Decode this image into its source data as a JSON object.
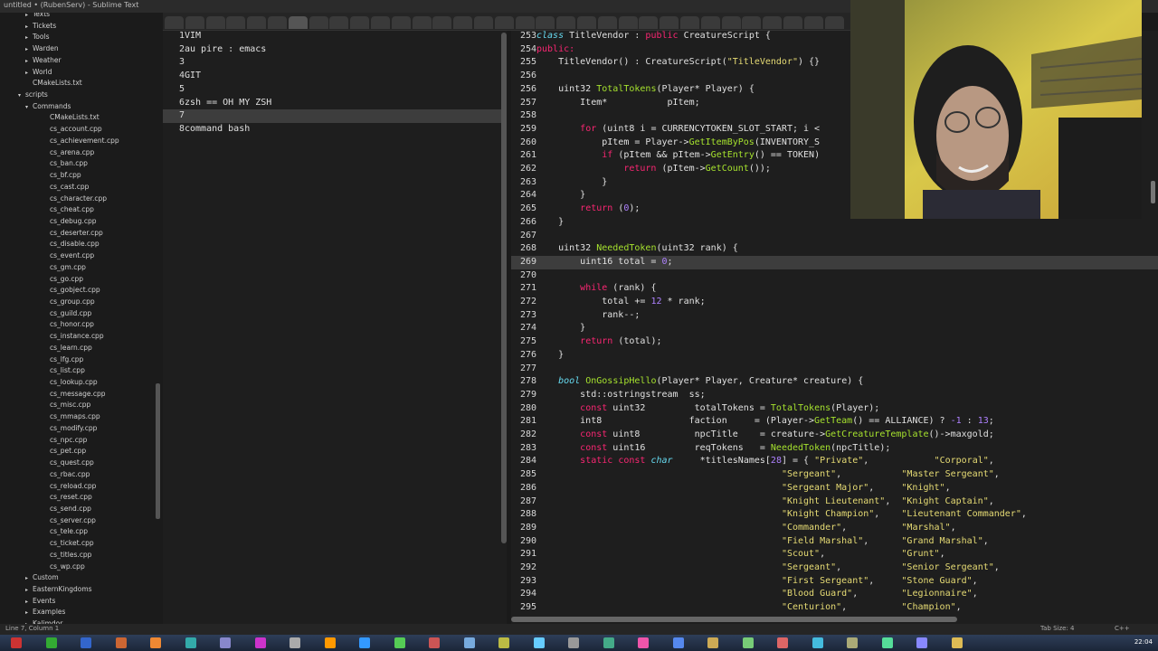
{
  "window": {
    "title": "untitled • (RubenServ) - Sublime Text"
  },
  "sidebar": {
    "items": [
      {
        "label": "Texts",
        "depth": 3,
        "arrow": "▸"
      },
      {
        "label": "Tickets",
        "depth": 3,
        "arrow": "▸"
      },
      {
        "label": "Tools",
        "depth": 3,
        "arrow": "▸"
      },
      {
        "label": "Warden",
        "depth": 3,
        "arrow": "▸"
      },
      {
        "label": "Weather",
        "depth": 3,
        "arrow": "▸"
      },
      {
        "label": "World",
        "depth": 3,
        "arrow": "▸"
      },
      {
        "label": "CMakeLists.txt",
        "depth": 3,
        "arrow": ""
      },
      {
        "label": "scripts",
        "depth": 2,
        "arrow": "▾"
      },
      {
        "label": "Commands",
        "depth": 3,
        "arrow": "▾"
      },
      {
        "label": "CMakeLists.txt",
        "depth": 4,
        "arrow": ""
      },
      {
        "label": "cs_account.cpp",
        "depth": 4,
        "arrow": ""
      },
      {
        "label": "cs_achievement.cpp",
        "depth": 4,
        "arrow": ""
      },
      {
        "label": "cs_arena.cpp",
        "depth": 4,
        "arrow": ""
      },
      {
        "label": "cs_ban.cpp",
        "depth": 4,
        "arrow": ""
      },
      {
        "label": "cs_bf.cpp",
        "depth": 4,
        "arrow": ""
      },
      {
        "label": "cs_cast.cpp",
        "depth": 4,
        "arrow": ""
      },
      {
        "label": "cs_character.cpp",
        "depth": 4,
        "arrow": ""
      },
      {
        "label": "cs_cheat.cpp",
        "depth": 4,
        "arrow": ""
      },
      {
        "label": "cs_debug.cpp",
        "depth": 4,
        "arrow": ""
      },
      {
        "label": "cs_deserter.cpp",
        "depth": 4,
        "arrow": ""
      },
      {
        "label": "cs_disable.cpp",
        "depth": 4,
        "arrow": ""
      },
      {
        "label": "cs_event.cpp",
        "depth": 4,
        "arrow": ""
      },
      {
        "label": "cs_gm.cpp",
        "depth": 4,
        "arrow": ""
      },
      {
        "label": "cs_go.cpp",
        "depth": 4,
        "arrow": ""
      },
      {
        "label": "cs_gobject.cpp",
        "depth": 4,
        "arrow": ""
      },
      {
        "label": "cs_group.cpp",
        "depth": 4,
        "arrow": ""
      },
      {
        "label": "cs_guild.cpp",
        "depth": 4,
        "arrow": ""
      },
      {
        "label": "cs_honor.cpp",
        "depth": 4,
        "arrow": ""
      },
      {
        "label": "cs_instance.cpp",
        "depth": 4,
        "arrow": ""
      },
      {
        "label": "cs_learn.cpp",
        "depth": 4,
        "arrow": ""
      },
      {
        "label": "cs_lfg.cpp",
        "depth": 4,
        "arrow": ""
      },
      {
        "label": "cs_list.cpp",
        "depth": 4,
        "arrow": ""
      },
      {
        "label": "cs_lookup.cpp",
        "depth": 4,
        "arrow": ""
      },
      {
        "label": "cs_message.cpp",
        "depth": 4,
        "arrow": ""
      },
      {
        "label": "cs_misc.cpp",
        "depth": 4,
        "arrow": ""
      },
      {
        "label": "cs_mmaps.cpp",
        "depth": 4,
        "arrow": ""
      },
      {
        "label": "cs_modify.cpp",
        "depth": 4,
        "arrow": ""
      },
      {
        "label": "cs_npc.cpp",
        "depth": 4,
        "arrow": ""
      },
      {
        "label": "cs_pet.cpp",
        "depth": 4,
        "arrow": ""
      },
      {
        "label": "cs_quest.cpp",
        "depth": 4,
        "arrow": ""
      },
      {
        "label": "cs_rbac.cpp",
        "depth": 4,
        "arrow": ""
      },
      {
        "label": "cs_reload.cpp",
        "depth": 4,
        "arrow": ""
      },
      {
        "label": "cs_reset.cpp",
        "depth": 4,
        "arrow": ""
      },
      {
        "label": "cs_send.cpp",
        "depth": 4,
        "arrow": ""
      },
      {
        "label": "cs_server.cpp",
        "depth": 4,
        "arrow": ""
      },
      {
        "label": "cs_tele.cpp",
        "depth": 4,
        "arrow": ""
      },
      {
        "label": "cs_ticket.cpp",
        "depth": 4,
        "arrow": ""
      },
      {
        "label": "cs_titles.cpp",
        "depth": 4,
        "arrow": ""
      },
      {
        "label": "cs_wp.cpp",
        "depth": 4,
        "arrow": ""
      },
      {
        "label": "Custom",
        "depth": 3,
        "arrow": "▸"
      },
      {
        "label": "EasternKingdoms",
        "depth": 3,
        "arrow": "▸"
      },
      {
        "label": "Events",
        "depth": 3,
        "arrow": "▸"
      },
      {
        "label": "Examples",
        "depth": 3,
        "arrow": "▸"
      },
      {
        "label": "Kalimdor",
        "depth": 3,
        "arrow": "▸"
      }
    ]
  },
  "left_editor": {
    "highlight_line": 7,
    "lines": [
      {
        "n": "1",
        "segs": [
          [
            "VIM",
            ""
          ]
        ]
      },
      {
        "n": "2",
        "segs": [
          [
            "au pire : emacs",
            ""
          ]
        ]
      },
      {
        "n": "3",
        "segs": [
          [
            "",
            ""
          ]
        ]
      },
      {
        "n": "4",
        "segs": [
          [
            "GIT",
            ""
          ]
        ]
      },
      {
        "n": "5",
        "segs": [
          [
            "",
            ""
          ]
        ]
      },
      {
        "n": "6",
        "segs": [
          [
            "zsh == OH MY ZSH",
            ""
          ]
        ]
      },
      {
        "n": "7",
        "segs": [
          [
            "",
            ""
          ]
        ]
      },
      {
        "n": "8",
        "segs": [
          [
            "command bash",
            ""
          ]
        ]
      }
    ]
  },
  "right_editor": {
    "highlight_line": 269,
    "lines": [
      {
        "n": "253",
        "segs": [
          [
            "class",
            "ty"
          ],
          [
            " TitleVendor : ",
            ""
          ],
          [
            "public",
            "kw"
          ],
          [
            " CreatureScript {",
            ""
          ]
        ]
      },
      {
        "n": "254",
        "segs": [
          [
            "public:",
            "acc"
          ]
        ]
      },
      {
        "n": "255",
        "segs": [
          [
            "    TitleVendor() : CreatureScript(",
            ""
          ],
          [
            "\"TitleVendor\"",
            "str"
          ],
          [
            ") {}",
            ""
          ]
        ]
      },
      {
        "n": "256",
        "segs": [
          [
            "",
            ""
          ]
        ]
      },
      {
        "n": "256",
        "segs": [
          [
            "    uint32 ",
            ""
          ],
          [
            "TotalTokens",
            "fn"
          ],
          [
            "(Player* Player) {",
            ""
          ]
        ]
      },
      {
        "n": "257",
        "segs": [
          [
            "        Item*           pItem;",
            ""
          ]
        ]
      },
      {
        "n": "258",
        "segs": [
          [
            "",
            ""
          ]
        ]
      },
      {
        "n": "259",
        "segs": [
          [
            "        ",
            ""
          ],
          [
            "for",
            "kw"
          ],
          [
            " (uint8 i = CURRENCYTOKEN_SLOT_START; i <",
            ""
          ]
        ]
      },
      {
        "n": "260",
        "segs": [
          [
            "            pItem = Player->",
            ""
          ],
          [
            "GetItemByPos",
            "fn"
          ],
          [
            "(INVENTORY_S",
            ""
          ]
        ]
      },
      {
        "n": "261",
        "segs": [
          [
            "            ",
            ""
          ],
          [
            "if",
            "kw"
          ],
          [
            " (pItem && pItem->",
            ""
          ],
          [
            "GetEntry",
            "fn"
          ],
          [
            "() == TOKEN)",
            ""
          ]
        ]
      },
      {
        "n": "262",
        "segs": [
          [
            "                ",
            ""
          ],
          [
            "return",
            "kw"
          ],
          [
            " (pItem->",
            ""
          ],
          [
            "GetCount",
            "fn"
          ],
          [
            "());",
            ""
          ]
        ]
      },
      {
        "n": "263",
        "segs": [
          [
            "            }",
            ""
          ]
        ]
      },
      {
        "n": "264",
        "segs": [
          [
            "        }",
            ""
          ]
        ]
      },
      {
        "n": "265",
        "segs": [
          [
            "        ",
            ""
          ],
          [
            "return",
            "kw"
          ],
          [
            " (",
            ""
          ],
          [
            "0",
            "num"
          ],
          [
            ");",
            ""
          ]
        ]
      },
      {
        "n": "266",
        "segs": [
          [
            "    }",
            ""
          ]
        ]
      },
      {
        "n": "267",
        "segs": [
          [
            "",
            ""
          ]
        ]
      },
      {
        "n": "268",
        "segs": [
          [
            "    uint32 ",
            ""
          ],
          [
            "NeededToken",
            "fn"
          ],
          [
            "(uint32 rank) {",
            ""
          ]
        ]
      },
      {
        "n": "269",
        "segs": [
          [
            "        uint16 total = ",
            ""
          ],
          [
            "0",
            "num"
          ],
          [
            ";",
            ""
          ]
        ]
      },
      {
        "n": "270",
        "segs": [
          [
            "",
            ""
          ]
        ]
      },
      {
        "n": "271",
        "segs": [
          [
            "        ",
            ""
          ],
          [
            "while",
            "kw"
          ],
          [
            " (rank) {",
            ""
          ]
        ]
      },
      {
        "n": "272",
        "segs": [
          [
            "            total += ",
            ""
          ],
          [
            "12",
            "num"
          ],
          [
            " * rank;",
            ""
          ]
        ]
      },
      {
        "n": "273",
        "segs": [
          [
            "            rank--;",
            ""
          ]
        ]
      },
      {
        "n": "274",
        "segs": [
          [
            "        }",
            ""
          ]
        ]
      },
      {
        "n": "275",
        "segs": [
          [
            "        ",
            ""
          ],
          [
            "return",
            "kw"
          ],
          [
            " (total);",
            ""
          ]
        ]
      },
      {
        "n": "276",
        "segs": [
          [
            "    }",
            ""
          ]
        ]
      },
      {
        "n": "277",
        "segs": [
          [
            "",
            ""
          ]
        ]
      },
      {
        "n": "278",
        "segs": [
          [
            "    ",
            ""
          ],
          [
            "bool",
            "ty"
          ],
          [
            " ",
            ""
          ],
          [
            "OnGossipHello",
            "fn"
          ],
          [
            "(Player* Player, Creature* creature) {",
            ""
          ]
        ]
      },
      {
        "n": "279",
        "segs": [
          [
            "        std::ostringstream  ss;",
            ""
          ]
        ]
      },
      {
        "n": "280",
        "segs": [
          [
            "        ",
            ""
          ],
          [
            "const",
            "kw"
          ],
          [
            " uint32         totalTokens = ",
            ""
          ],
          [
            "TotalTokens",
            "fn"
          ],
          [
            "(Player);",
            ""
          ]
        ]
      },
      {
        "n": "281",
        "segs": [
          [
            "        int8                faction     = (Player->",
            ""
          ],
          [
            "GetTeam",
            "fn"
          ],
          [
            "() == ALLIANCE) ? ",
            ""
          ],
          [
            "-1",
            "num"
          ],
          [
            " : ",
            ""
          ],
          [
            "13",
            "num"
          ],
          [
            ";",
            ""
          ]
        ]
      },
      {
        "n": "282",
        "segs": [
          [
            "        ",
            ""
          ],
          [
            "const",
            "kw"
          ],
          [
            " uint8          npcTitle    = creature->",
            ""
          ],
          [
            "GetCreatureTemplate",
            "fn"
          ],
          [
            "()->maxgold;",
            ""
          ]
        ]
      },
      {
        "n": "283",
        "segs": [
          [
            "        ",
            ""
          ],
          [
            "const",
            "kw"
          ],
          [
            " uint16         reqTokens   = ",
            ""
          ],
          [
            "NeededToken",
            "fn"
          ],
          [
            "(npcTitle);",
            ""
          ]
        ]
      },
      {
        "n": "284",
        "segs": [
          [
            "        ",
            ""
          ],
          [
            "static const",
            "kw"
          ],
          [
            " ",
            ""
          ],
          [
            "char",
            "ty"
          ],
          [
            "     *titlesNames[",
            ""
          ],
          [
            "28",
            "num"
          ],
          [
            "] = { ",
            ""
          ],
          [
            "\"Private\"",
            "str"
          ],
          [
            ",            ",
            ""
          ],
          [
            "\"Corporal\"",
            "str"
          ],
          [
            ",",
            ""
          ]
        ]
      },
      {
        "n": "285",
        "segs": [
          [
            "                                             ",
            ""
          ],
          [
            "\"Sergeant\"",
            "str"
          ],
          [
            ",           ",
            ""
          ],
          [
            "\"Master Sergeant\"",
            "str"
          ],
          [
            ",",
            ""
          ]
        ]
      },
      {
        "n": "286",
        "segs": [
          [
            "                                             ",
            ""
          ],
          [
            "\"Sergeant Major\"",
            "str"
          ],
          [
            ",     ",
            ""
          ],
          [
            "\"Knight\"",
            "str"
          ],
          [
            ",",
            ""
          ]
        ]
      },
      {
        "n": "287",
        "segs": [
          [
            "                                             ",
            ""
          ],
          [
            "\"Knight Lieutenant\"",
            "str"
          ],
          [
            ",  ",
            ""
          ],
          [
            "\"Knight Captain\"",
            "str"
          ],
          [
            ",",
            ""
          ]
        ]
      },
      {
        "n": "288",
        "segs": [
          [
            "                                             ",
            ""
          ],
          [
            "\"Knight Champion\"",
            "str"
          ],
          [
            ",    ",
            ""
          ],
          [
            "\"Lieutenant Commander\"",
            "str"
          ],
          [
            ",",
            ""
          ]
        ]
      },
      {
        "n": "289",
        "segs": [
          [
            "                                             ",
            ""
          ],
          [
            "\"Commander\"",
            "str"
          ],
          [
            ",          ",
            ""
          ],
          [
            "\"Marshal\"",
            "str"
          ],
          [
            ",",
            ""
          ]
        ]
      },
      {
        "n": "290",
        "segs": [
          [
            "                                             ",
            ""
          ],
          [
            "\"Field Marshal\"",
            "str"
          ],
          [
            ",      ",
            ""
          ],
          [
            "\"Grand Marshal\"",
            "str"
          ],
          [
            ",",
            ""
          ]
        ]
      },
      {
        "n": "291",
        "segs": [
          [
            "                                             ",
            ""
          ],
          [
            "\"Scout\"",
            "str"
          ],
          [
            ",              ",
            ""
          ],
          [
            "\"Grunt\"",
            "str"
          ],
          [
            ",",
            ""
          ]
        ]
      },
      {
        "n": "292",
        "segs": [
          [
            "                                             ",
            ""
          ],
          [
            "\"Sergeant\"",
            "str"
          ],
          [
            ",           ",
            ""
          ],
          [
            "\"Senior Sergeant\"",
            "str"
          ],
          [
            ",",
            ""
          ]
        ]
      },
      {
        "n": "293",
        "segs": [
          [
            "                                             ",
            ""
          ],
          [
            "\"First Sergeant\"",
            "str"
          ],
          [
            ",     ",
            ""
          ],
          [
            "\"Stone Guard\"",
            "str"
          ],
          [
            ",",
            ""
          ]
        ]
      },
      {
        "n": "294",
        "segs": [
          [
            "                                             ",
            ""
          ],
          [
            "\"Blood Guard\"",
            "str"
          ],
          [
            ",        ",
            ""
          ],
          [
            "\"Legionnaire\"",
            "str"
          ],
          [
            ",",
            ""
          ]
        ]
      },
      {
        "n": "295",
        "segs": [
          [
            "                                             ",
            ""
          ],
          [
            "\"Centurion\"",
            "str"
          ],
          [
            ",          ",
            ""
          ],
          [
            "\"Champion\"",
            "str"
          ],
          [
            ",",
            ""
          ]
        ]
      }
    ]
  },
  "statusbar": {
    "position": "Line 7, Column 1",
    "tab_size": "Tab Size: 4",
    "syntax": "C++"
  },
  "taskbar": {
    "clock": "22:04"
  },
  "colors": {
    "keyword": "#f92672",
    "type": "#66d9ef",
    "function": "#a6e22e",
    "number": "#ae81ff",
    "string": "#e6db74"
  }
}
